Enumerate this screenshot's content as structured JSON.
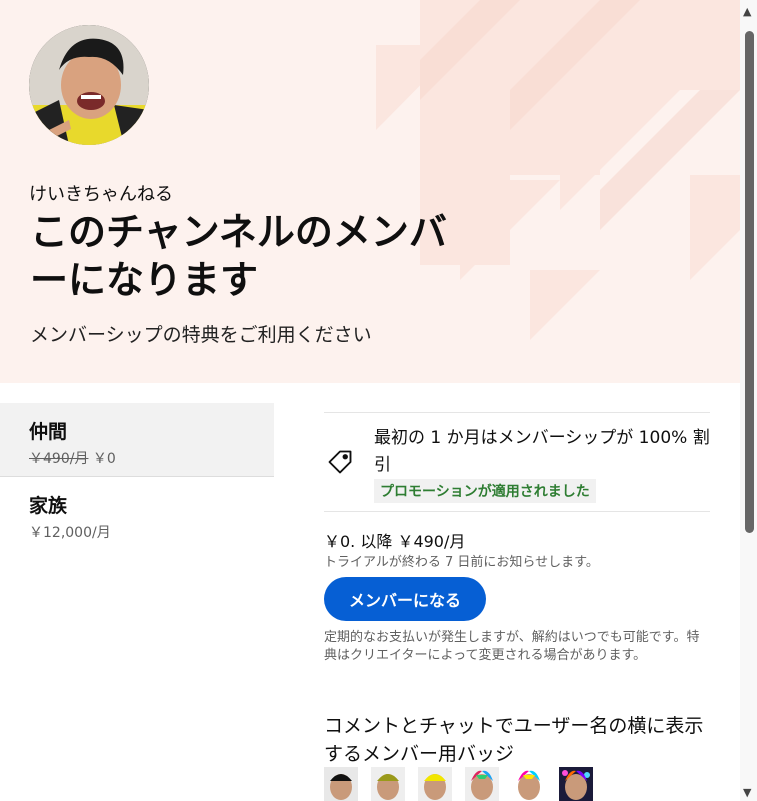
{
  "hero": {
    "channel_name": "けいきちゃんねる",
    "title": "このチャンネルのメンバーになります",
    "subtitle": "メンバーシップの特典をご利用ください"
  },
  "tiers": [
    {
      "name": "仲間",
      "original_price": "￥490/月",
      "price": "￥0",
      "selected": true
    },
    {
      "name": "家族",
      "price": "￥12,000/月",
      "selected": false
    }
  ],
  "promotion": {
    "text": "最初の 1 か月はメンバーシップが 100% 割引",
    "badge": "プロモーションが適用されました",
    "icon": "tag-icon"
  },
  "pricing": {
    "line": "￥0. 以降 ￥490/月",
    "trial_note": "トライアルが終わる 7 日前にお知らせします。"
  },
  "join_button": "メンバーになる",
  "fine_print": "定期的なお支払いが発生しますが、解約はいつでも可能です。特典はクリエイターによって変更される場合があります。",
  "perk": {
    "title": "コメントとチャットでユーザー名の横に表示するメンバー用バッジ",
    "badge_count": 6
  },
  "colors": {
    "hero_bg": "#fdf2ee",
    "accent": "#065fd4",
    "promo_green": "#2e7d32"
  }
}
